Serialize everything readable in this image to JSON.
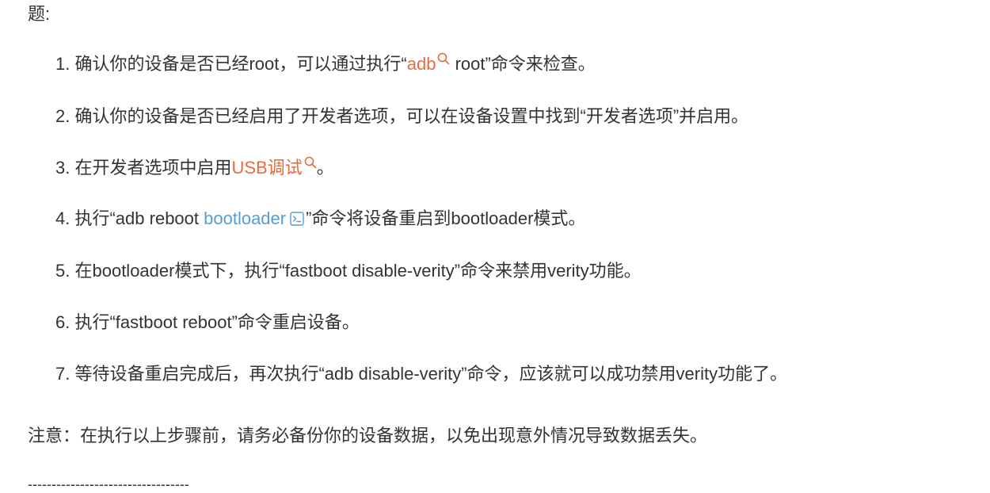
{
  "intro_tail": "题:",
  "steps": [
    {
      "num": "1.",
      "before": "确认你的设备是否已经root，可以通过执行“",
      "keyword": "adb",
      "after": " root”命令来检查。"
    },
    {
      "num": "2.",
      "text": "确认你的设备是否已经启用了开发者选项，可以在设备设置中找到“开发者选项”并启用。"
    },
    {
      "num": "3.",
      "before": "在开发者选项中启用",
      "keyword": "USB调试",
      "after": "。"
    },
    {
      "num": "4.",
      "before": "执行“adb reboot ",
      "keyword": "bootloader",
      "after": "”命令将设备重启到bootloader模式。"
    },
    {
      "num": "5.",
      "text": "在bootloader模式下，执行“fastboot disable-verity”命令来禁用verity功能。"
    },
    {
      "num": "6.",
      "text": "执行“fastboot reboot”命令重启设备。"
    },
    {
      "num": "7.",
      "text": "等待设备重启完成后，再次执行“adb disable-verity”命令，应该就可以成功禁用verity功能了。"
    }
  ],
  "note": "注意：在执行以上步骤前，请务必备份你的设备数据，以免出现意外情况导致数据丢失。",
  "separator": "----------------------------------",
  "colors": {
    "text": "#333333",
    "search_keyword": "#e96a3a",
    "code_keyword": "#5a9bd4"
  },
  "icons": {
    "search_keyword_icon": "search-icon",
    "code_keyword_icon": "terminal-icon"
  }
}
